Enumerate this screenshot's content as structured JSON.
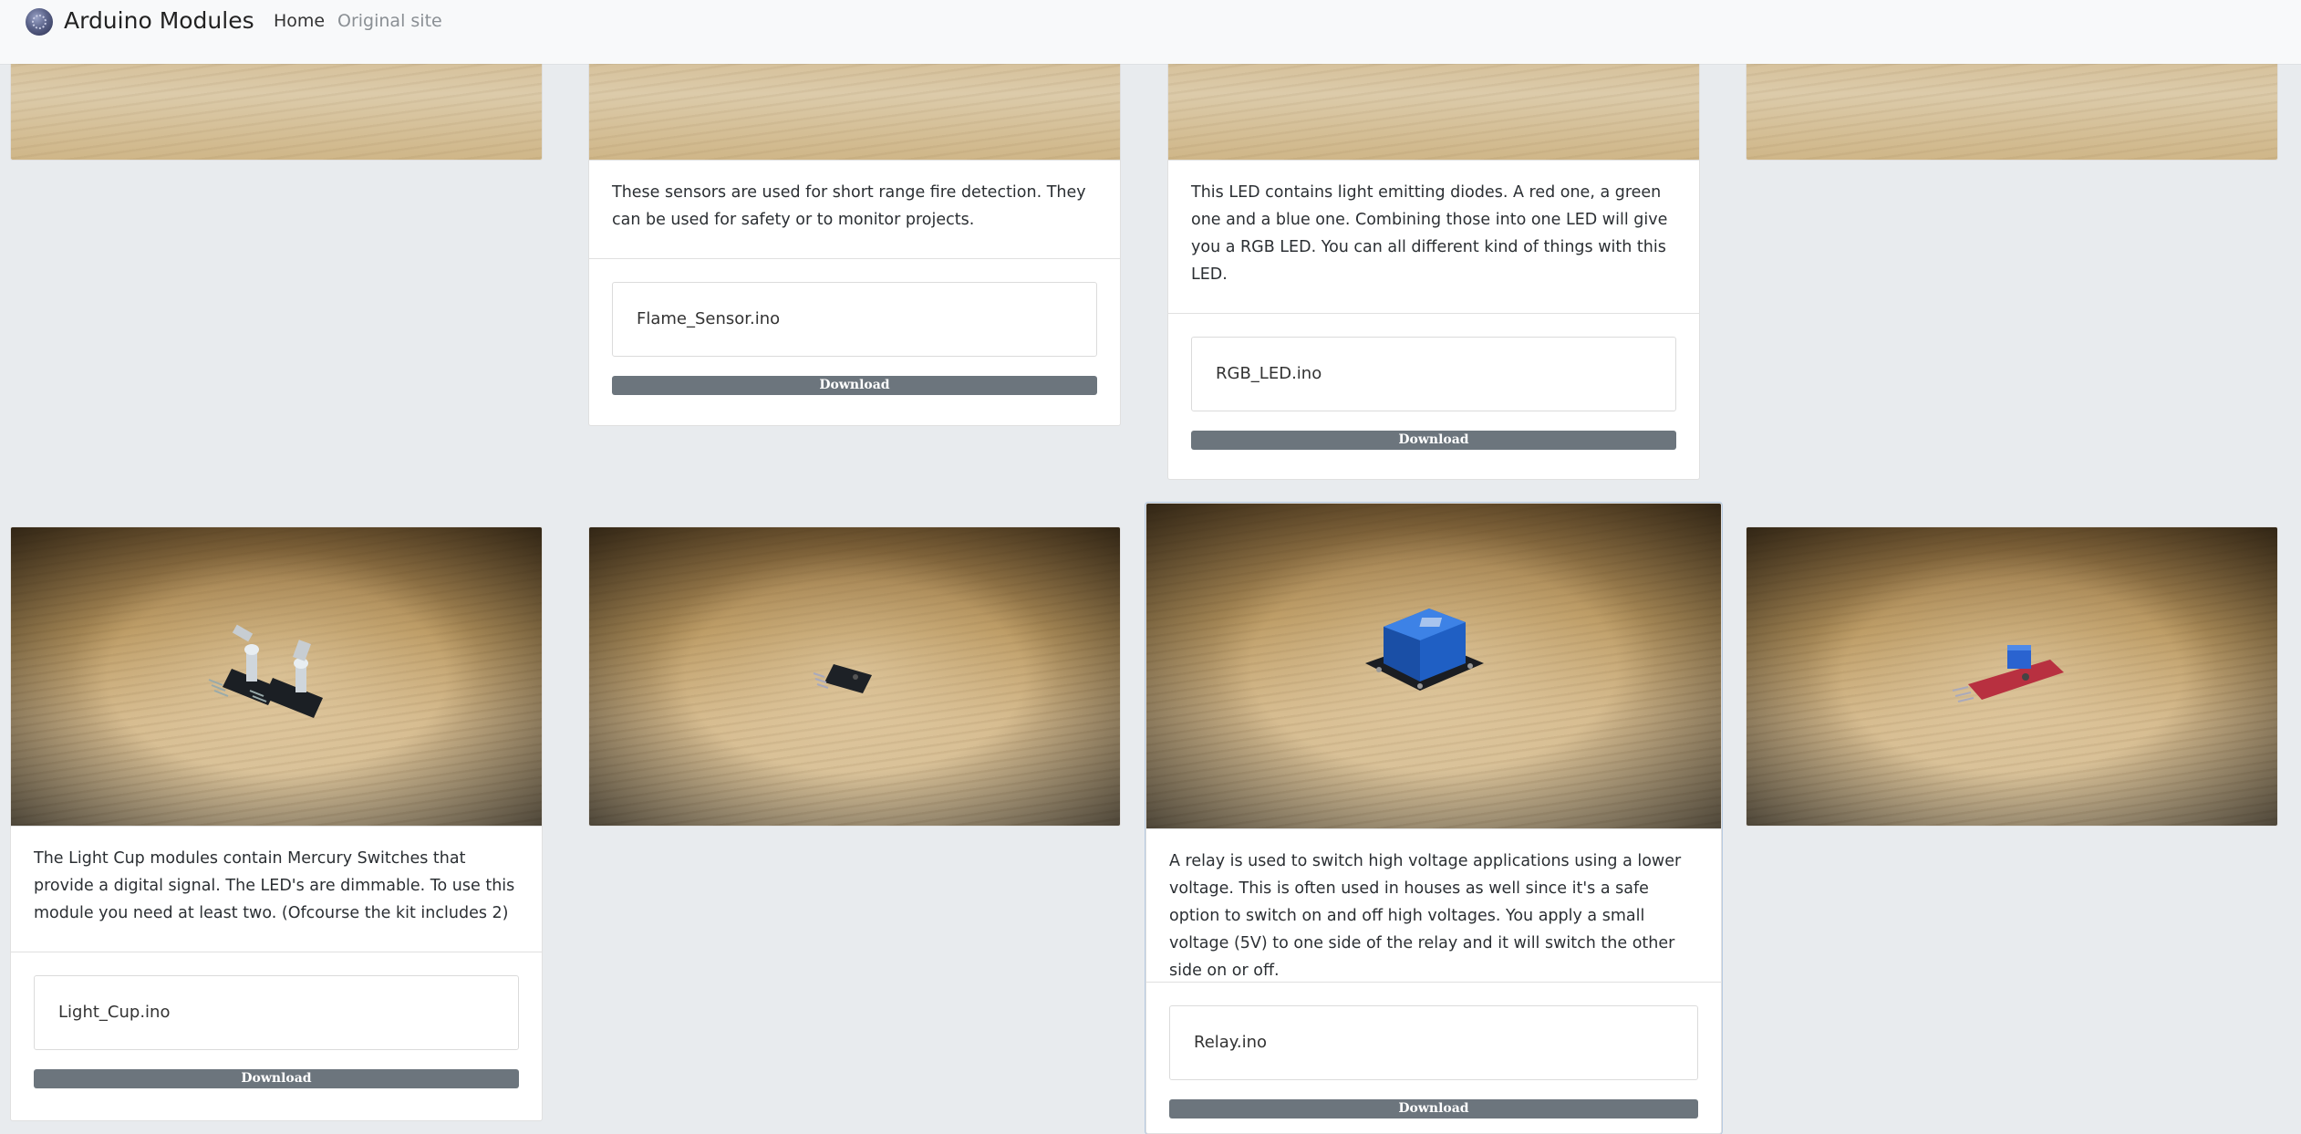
{
  "navbar": {
    "brand": "Arduino Modules",
    "links": [
      {
        "label": "Home",
        "active": true
      },
      {
        "label": "Original site",
        "active": false
      }
    ]
  },
  "top_row": [
    {
      "description": "",
      "file": "",
      "download_label": ""
    },
    {
      "description": "These sensors are used for short range fire detection. They can be used for safety or to monitor projects.",
      "file": "Flame_Sensor.ino",
      "download_label": "Download"
    },
    {
      "description": "This LED contains light emitting diodes. A red one, a green one and a blue one. Combining those into one LED will give you a RGB LED. You can all different kind of things with this LED.",
      "file": "RGB_LED.ino",
      "download_label": "Download"
    },
    {
      "description": "",
      "file": "",
      "download_label": ""
    }
  ],
  "bottom_row": [
    {
      "image_icon": "light-cup-module",
      "description": "The Light Cup modules contain Mercury Switches that provide a digital signal. The LED's are dimmable. To use this module you need at least two. (Ofcourse the kit includes 2)",
      "file": "Light_Cup.ino",
      "download_label": "Download"
    },
    {
      "image_icon": "sensor-module",
      "description": "",
      "file": "",
      "download_label": ""
    },
    {
      "image_icon": "relay-module",
      "description": "A relay is used to switch high voltage applications using a lower voltage. This is often used in houses as well since it's a safe option to switch on and off high voltages. You apply a small voltage (5V) to one side of the relay and it will switch the other side on or off.",
      "file": "Relay.ino",
      "download_label": "Download"
    },
    {
      "image_icon": "potentiometer-sensor-module",
      "description": "",
      "file": "",
      "download_label": ""
    }
  ],
  "colors": {
    "navbar_bg": "#f8f9fa",
    "page_bg": "#e8ebee",
    "button_bg": "#6c757d"
  }
}
